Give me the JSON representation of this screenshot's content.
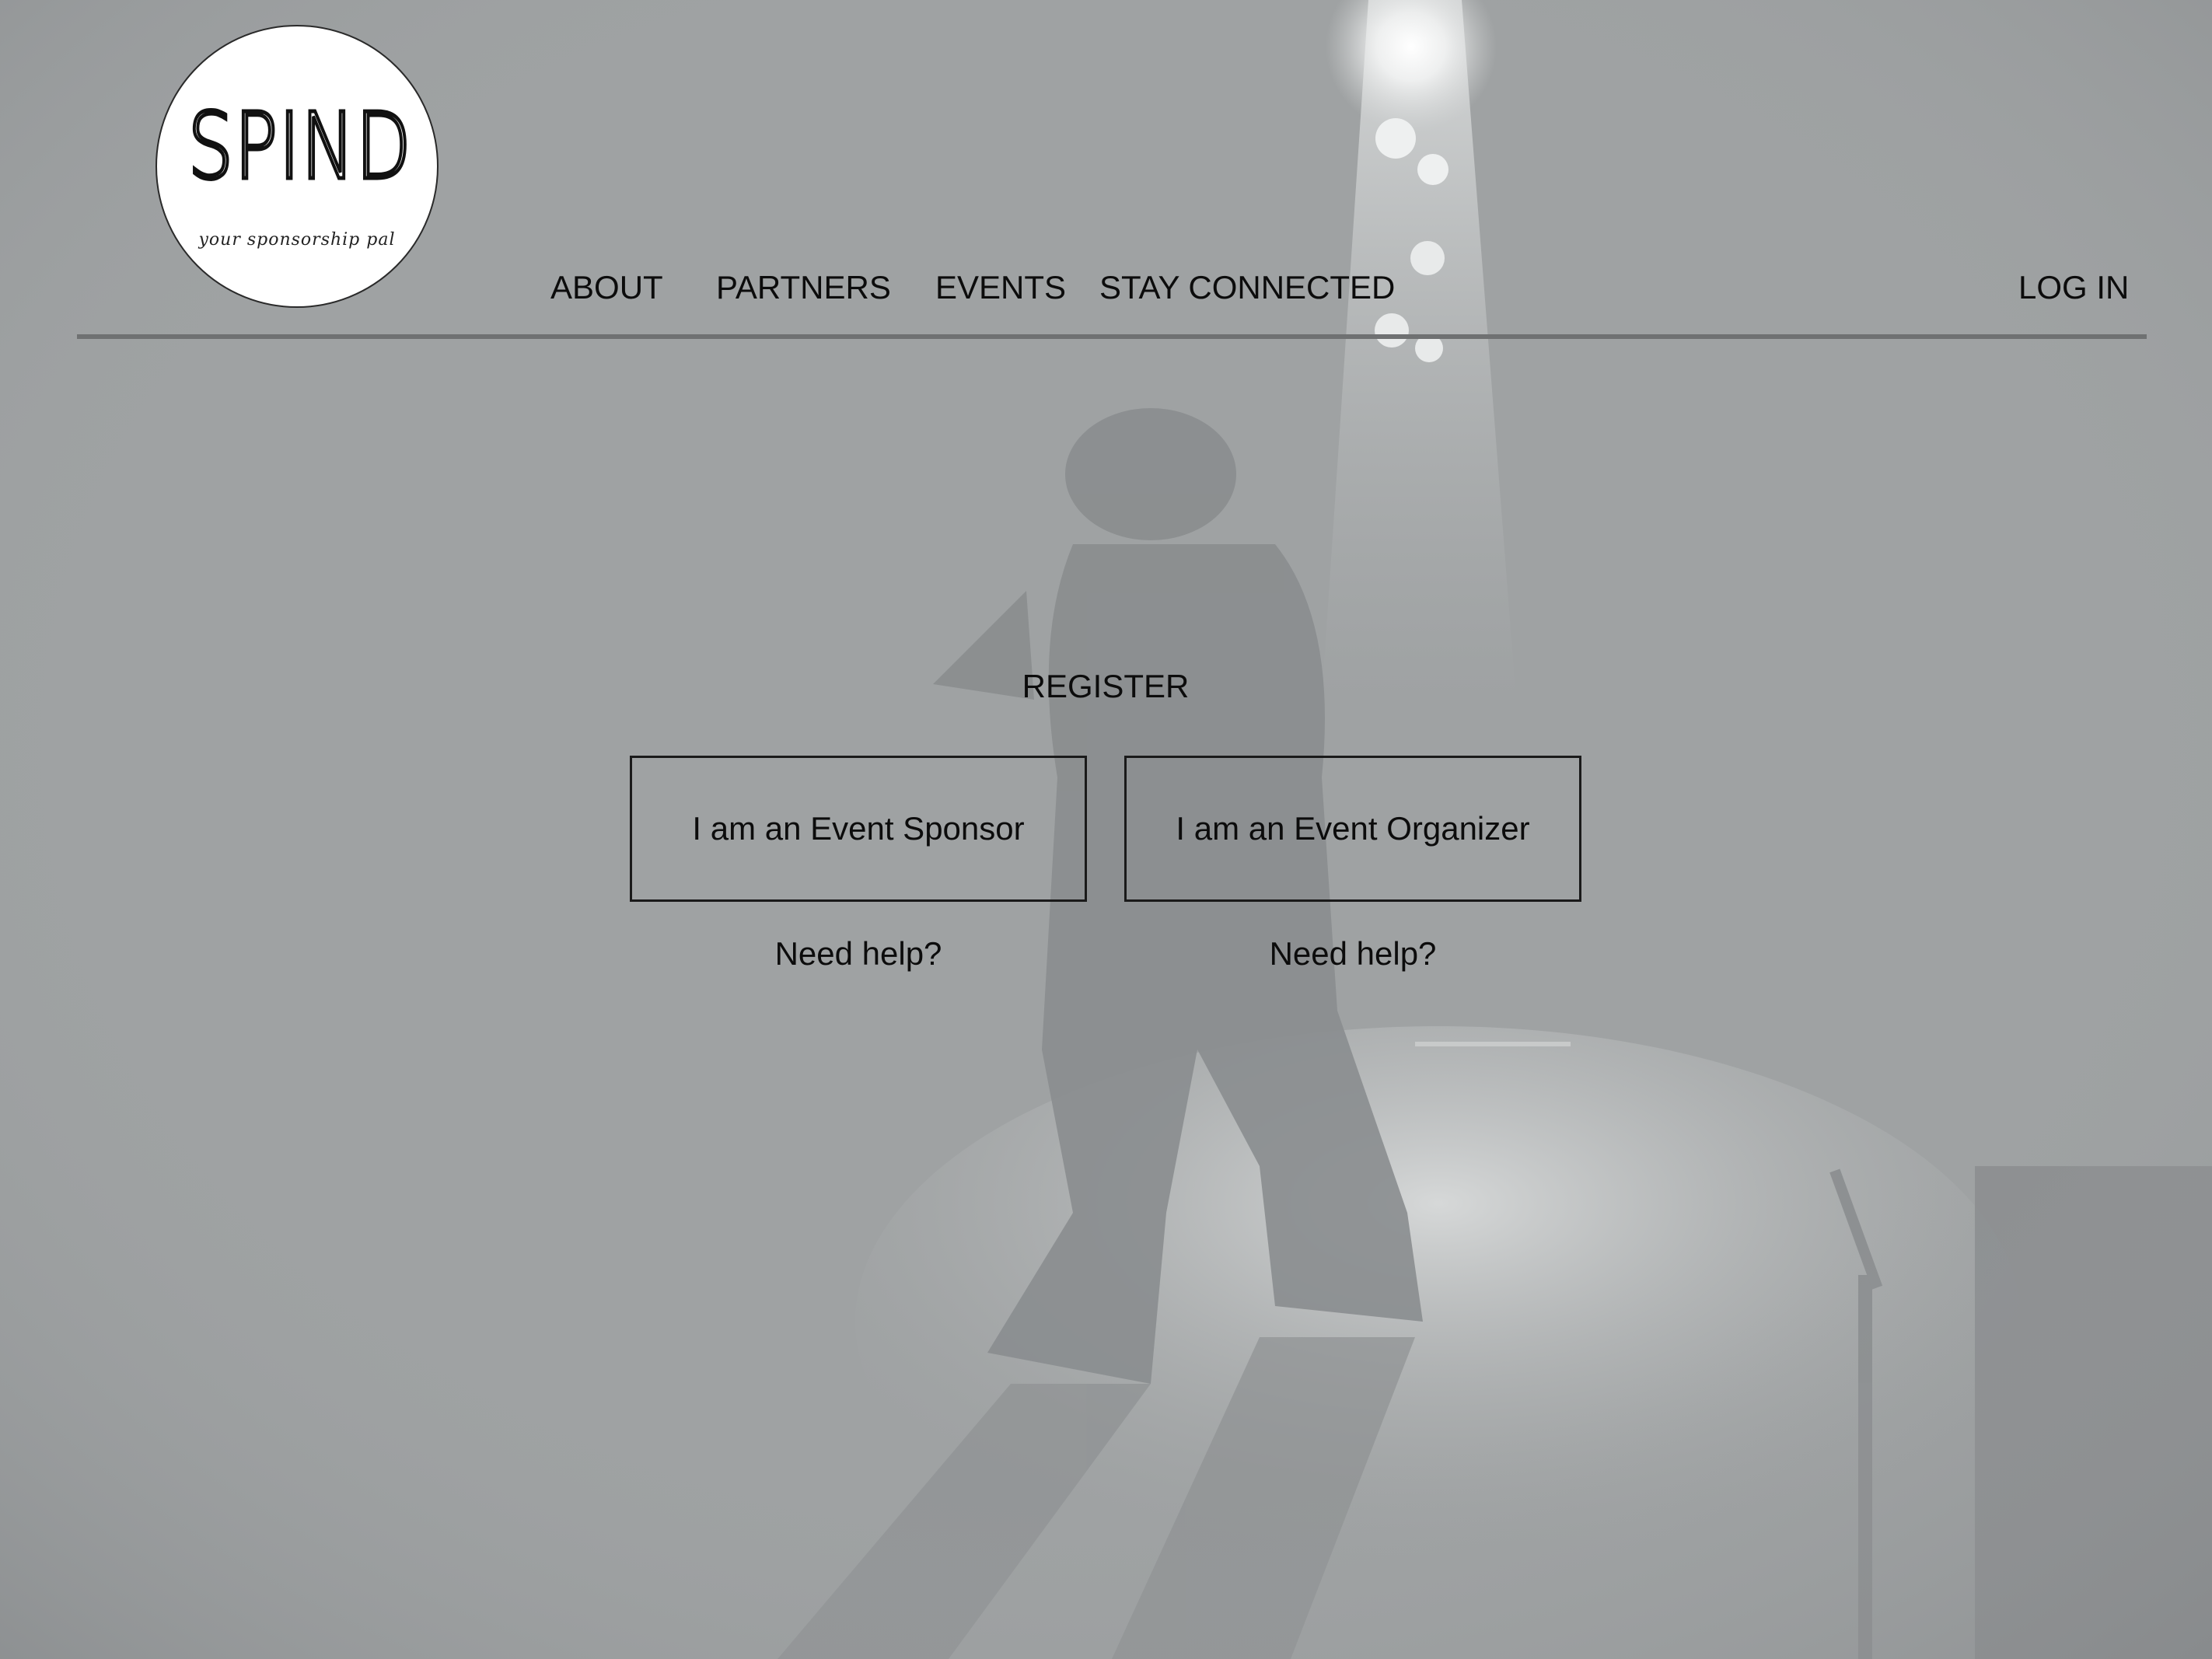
{
  "logo": {
    "wordmark": "SPIND",
    "tagline": "your sponsorship pal"
  },
  "nav": {
    "items": [
      {
        "label": "ABOUT"
      },
      {
        "label": "PARTNERS"
      },
      {
        "label": "EVENTS"
      },
      {
        "label": "STAY CONNECTED"
      }
    ],
    "login_label": "LOG IN"
  },
  "register": {
    "title": "REGISTER",
    "sponsor_button": "I am an Event Sponsor",
    "organizer_button": "I am an Event Organizer",
    "sponsor_help": "Need help?",
    "organizer_help": "Need help?"
  },
  "colors": {
    "background": "#9ea1a2",
    "text": "#0c0c0c",
    "divider": "#6f7172"
  }
}
